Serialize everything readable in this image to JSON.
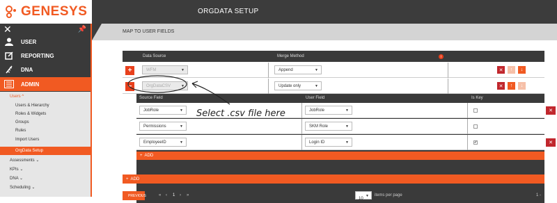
{
  "brand": {
    "name": "GENESYS"
  },
  "colors": {
    "accent": "#f15a22",
    "dark": "#3a3a3a",
    "danger": "#c1272d"
  },
  "sidebar": {
    "close_icon": "close-icon",
    "pin_icon": "pin-icon",
    "items": [
      {
        "label": "USER",
        "icon": "user-icon"
      },
      {
        "label": "REPORTING",
        "icon": "edit-icon"
      },
      {
        "label": "DNA",
        "icon": "dna-icon"
      },
      {
        "label": "ADMIN",
        "icon": "admin-icon"
      }
    ],
    "submenu_heading": "Users ^",
    "submenu": [
      "Users & Hierarchy",
      "Roles & Widgets",
      "Groups",
      "Rules",
      "Import Users",
      "OrgData Setup"
    ],
    "sections": [
      "Assessments ⌄",
      "KPIs ⌄",
      "DNA ⌄",
      "Scheduling ⌄"
    ]
  },
  "header": {
    "title": "ORGDATA SETUP",
    "subtitle": "MAP TO USER FIELDS"
  },
  "table": {
    "col_data_source": "Data Source",
    "col_merge_method": "Merge Method",
    "info_icon": "i",
    "rows": [
      {
        "toggle": "+",
        "data_source": "WFM",
        "merge_method": "Append"
      },
      {
        "toggle": "−",
        "data_source": "OrgDataCSV",
        "merge_method": "Update only"
      }
    ]
  },
  "field_map": {
    "col_source": "Source Field",
    "col_user": "User Field",
    "col_key": "Is Key",
    "rows": [
      {
        "source": "JobRole",
        "user": "JobRole",
        "is_key": ""
      },
      {
        "source": "Permissions",
        "user": "SKM Role",
        "is_key": ""
      },
      {
        "source": "EmployeeID",
        "user": "Login ID",
        "is_key": "✔"
      }
    ],
    "add_label": "ADD",
    "pager": {
      "first": "«",
      "prev": "‹",
      "page": "1",
      "next": "›",
      "last": "»",
      "per_page_value": "10",
      "per_page_label": "items per page",
      "range": "1 -"
    }
  },
  "outer_add_label": "ADD",
  "previous_label": "PREVIOUS",
  "annotation": {
    "text": "Select .csv file here"
  }
}
